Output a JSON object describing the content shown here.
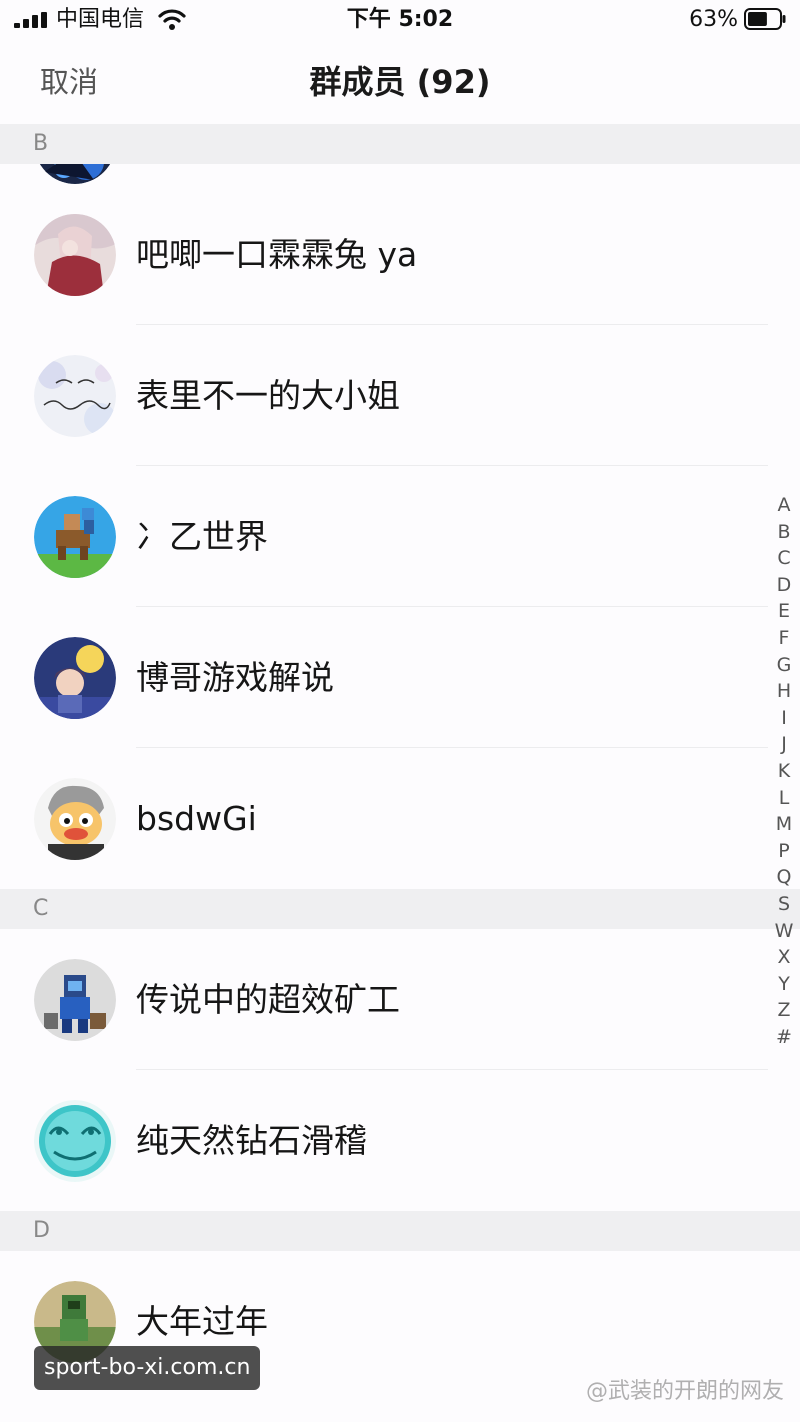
{
  "status_bar": {
    "carrier": "中国电信",
    "time": "下午 5:02",
    "battery_percent": "63%",
    "battery_level": 0.63
  },
  "nav": {
    "cancel_label": "取消",
    "title": "群成员 (92)"
  },
  "sections": [
    {
      "letter": "B",
      "members": [
        {
          "name": "",
          "avatar": "blue-gem-avatar"
        },
        {
          "name": "吧唧一口霖霖兔 ya",
          "avatar": "girl-photo-avatar"
        },
        {
          "name": "表里不一的大小姐",
          "avatar": "hello-september-avatar"
        },
        {
          "name": "冫乙世界",
          "avatar": "minecraft-horse-avatar"
        },
        {
          "name": "博哥游戏解说",
          "avatar": "anime-character-avatar"
        },
        {
          "name": "bsdwGi",
          "avatar": "cartoon-bird-avatar"
        }
      ]
    },
    {
      "letter": "C",
      "members": [
        {
          "name": "传说中的超效矿工",
          "avatar": "minecraft-miner-avatar"
        },
        {
          "name": "纯天然钻石滑稽",
          "avatar": "diamond-funny-face-avatar"
        }
      ]
    },
    {
      "letter": "D",
      "members": [
        {
          "name": "大年过年",
          "avatar": "minecraft-scene-avatar"
        }
      ]
    }
  ],
  "index_letters": [
    "A",
    "B",
    "C",
    "D",
    "E",
    "F",
    "G",
    "H",
    "I",
    "J",
    "K",
    "L",
    "M",
    "P",
    "Q",
    "S",
    "W",
    "X",
    "Y",
    "Z",
    "#"
  ],
  "watermarks": {
    "url": "sport-bo-xi.com.cn",
    "author": "@武装的开朗的网友"
  }
}
